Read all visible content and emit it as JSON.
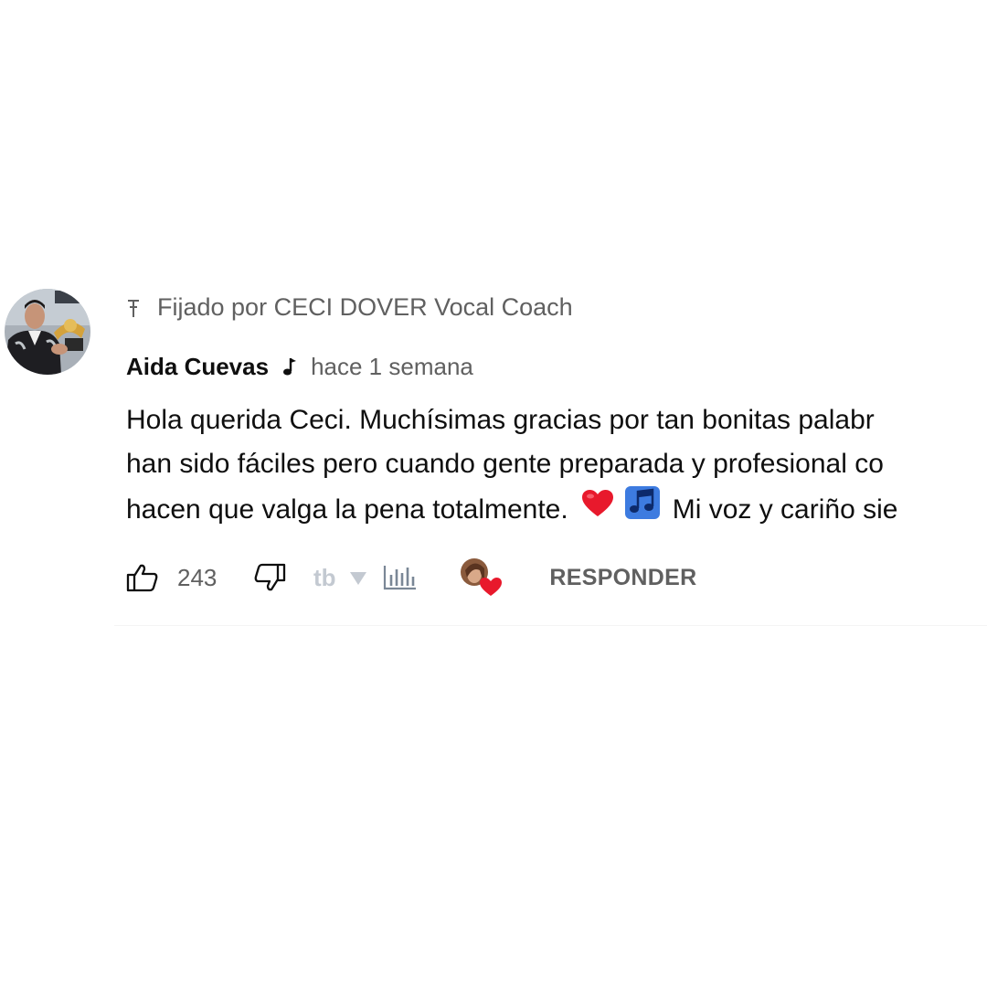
{
  "comment": {
    "pinned_text": "Fijado por CECI DOVER Vocal Coach",
    "author": "Aida Cuevas",
    "timestamp": "hace 1 semana",
    "lines": [
      "Hola querida Ceci. Muchísimas gracias por tan bonitas palabr",
      "han sido fáciles pero cuando gente preparada y profesional co",
      "hacen que valga la pena totalmente."
    ],
    "line3_suffix": "Mi voz y cariño sie",
    "like_count": "243",
    "reply_label": "RESPONDER",
    "icons": {
      "pin": "pin-icon",
      "badge": "music-note-icon",
      "like": "thumbs-up-icon",
      "dislike": "thumbs-down-icon",
      "extension": "tb-extension-icon",
      "dropdown": "caret-down-icon",
      "stats": "bar-chart-icon",
      "creator_heart": "creator-heart-icon",
      "emoji_1": "red-heart-emoji",
      "emoji_2": "musical-notes-emoji"
    },
    "colors": {
      "text": "#0f0f0f",
      "secondary": "#606060",
      "heart": "#e8192c"
    }
  }
}
